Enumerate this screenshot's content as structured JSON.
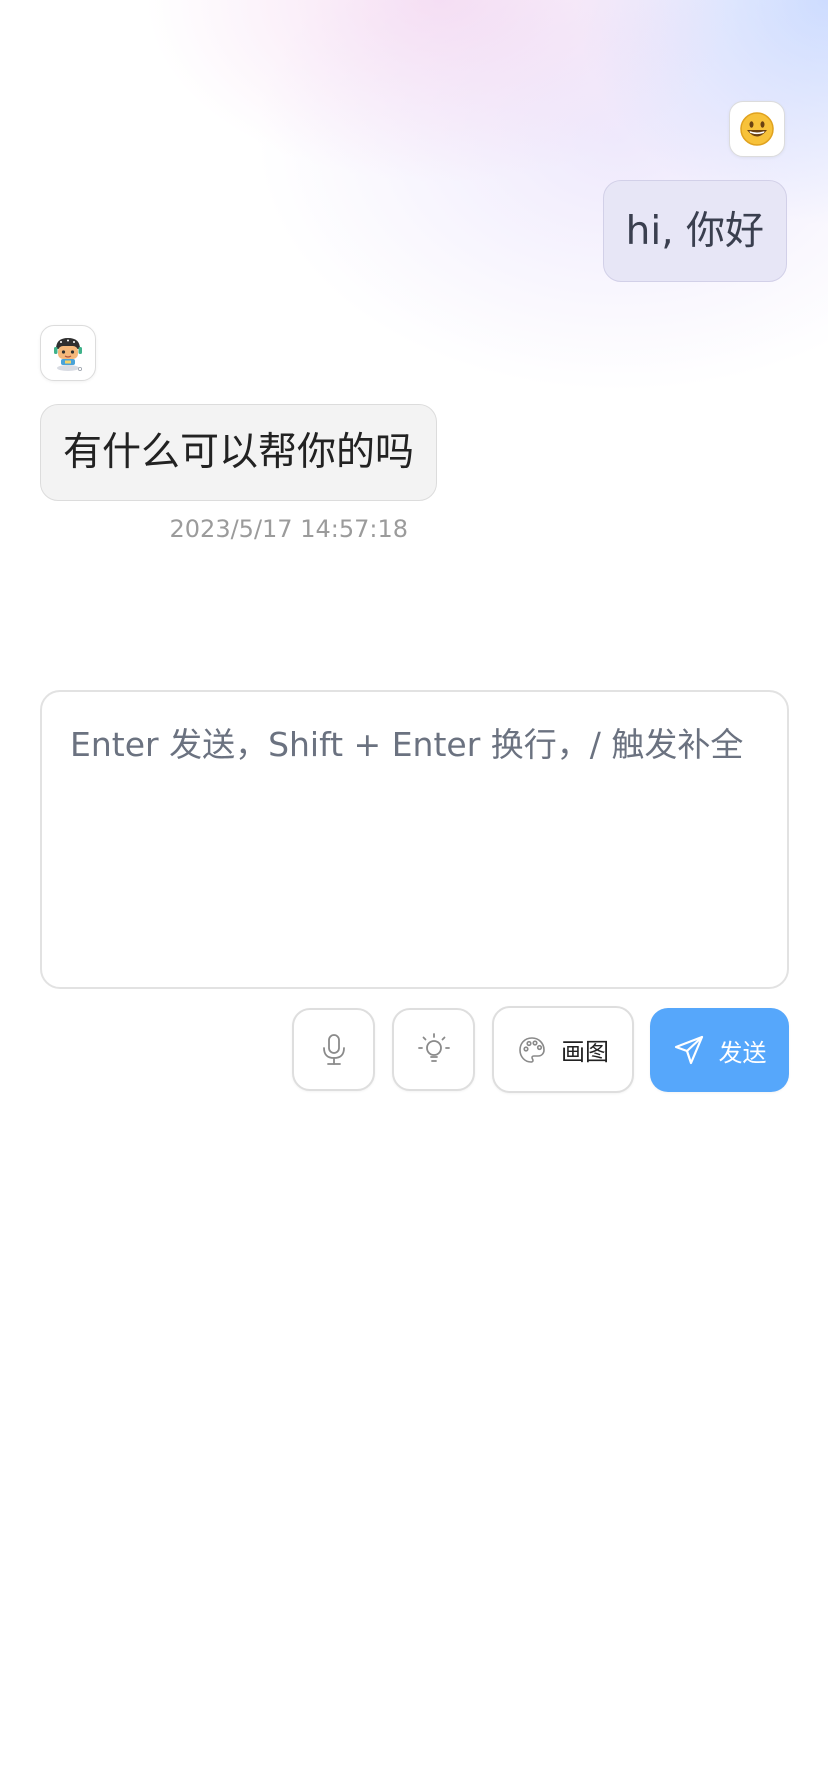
{
  "conversation": {
    "user_message": "hi, 你好",
    "bot_message": "有什么可以帮你的吗",
    "bot_timestamp": "2023/5/17 14:57:18"
  },
  "avatars": {
    "user_icon": "smiley-emoji-icon",
    "bot_icon": "robot-icon"
  },
  "composer": {
    "placeholder": "Enter 发送，Shift + Enter 换行，/ 触发补全",
    "value": ""
  },
  "toolbar": {
    "mic_icon": "microphone-icon",
    "prompt_icon": "lightbulb-icon",
    "draw_icon": "palette-icon",
    "draw_label": "画图",
    "send_icon": "send-icon",
    "send_label": "发送"
  },
  "colors": {
    "accent": "#56a7fb",
    "user_bubble": "#e7e6f6",
    "bot_bubble": "#f3f3f3",
    "timestamp": "#9b9b9b"
  }
}
